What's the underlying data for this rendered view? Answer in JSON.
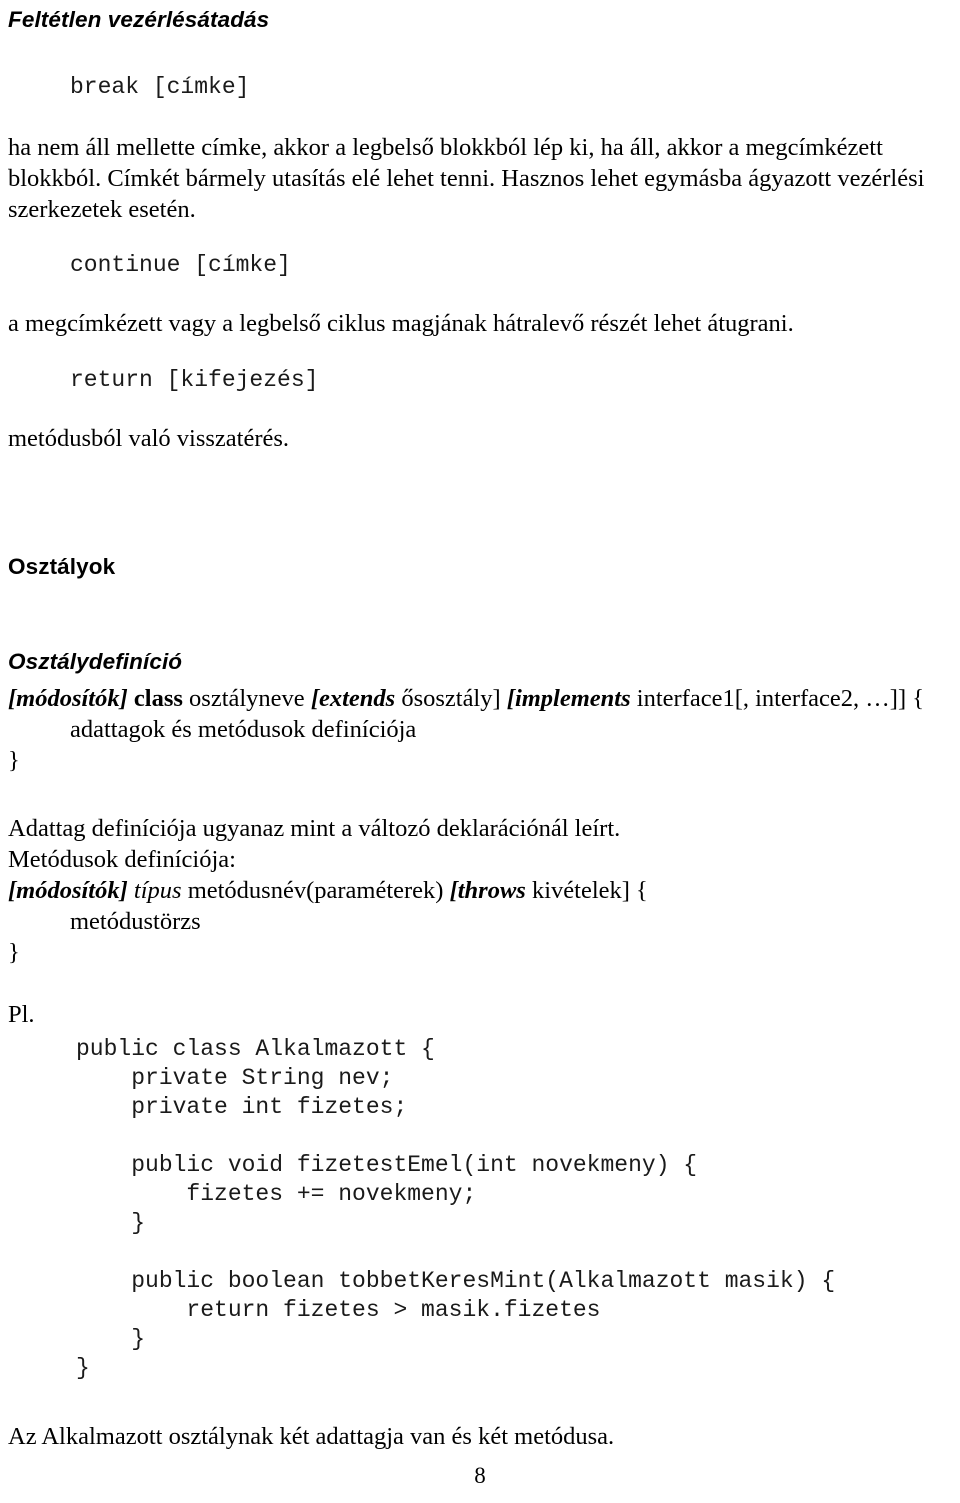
{
  "document": {
    "language": "hu",
    "page_number": "8",
    "section_heading": "Feltétlen vezérlésátadás"
  },
  "break_block": {
    "code": "break [címke]",
    "description": "ha nem áll mellette címke, akkor a legbelső blokkból lép ki, ha áll, akkor a megcímkézett blokkból. Címkét bármely utasítás elé lehet tenni. Hasznos lehet egymásba ágyazott vezérlési szerkezetek esetén."
  },
  "continue_block": {
    "code": "continue [címke]",
    "description": "a megcímkézett vagy a legbelső ciklus magjának hátralevő részét lehet átugrani."
  },
  "return_block": {
    "code": "return [kifejezés]",
    "description": "metódusból való visszatérés."
  },
  "classes_section": {
    "heading": "Osztályok",
    "definition_heading": "Osztálydefiníció",
    "class_syntax": {
      "part_modifiers": "[módosítók]",
      "part_class_keyword": "class",
      "part_class_name": " osztályneve ",
      "part_extends_open": "[extends",
      "part_superclass": " ősosztály] ",
      "part_implements_open": "[implements",
      "part_interfaces": " interface1[, interface2, …]] {"
    },
    "class_body_line": "adattagok és metódusok definíciója",
    "class_close_brace": "}",
    "field_note": "Adattag definíciója ugyanaz mint a változó deklarációnál leírt.",
    "method_note": "Metódusok definíciója:",
    "method_syntax": {
      "part_modifiers": "[módosítók]",
      "part_type": " típus",
      "part_signature": " metódusnév(paraméterek) ",
      "part_throws_open": "[throws",
      "part_exceptions": " kivételek] {"
    },
    "method_body_line": "metódustörzs",
    "method_close_brace": "}",
    "example_label": "Pl.",
    "example_code": "public class Alkalmazott {\n    private String nev;\n    private int fizetes;\n\n    public void fizetestEmel(int novekmeny) {\n        fizetes += novekmeny;\n    }\n\n    public boolean tobbetKeresMint(Alkalmazott masik) {\n        return fizetes > masik.fizetes\n    }\n}",
    "closing_note": "Az Alkalmazott osztálynak két adattagja van és két metódusa."
  }
}
